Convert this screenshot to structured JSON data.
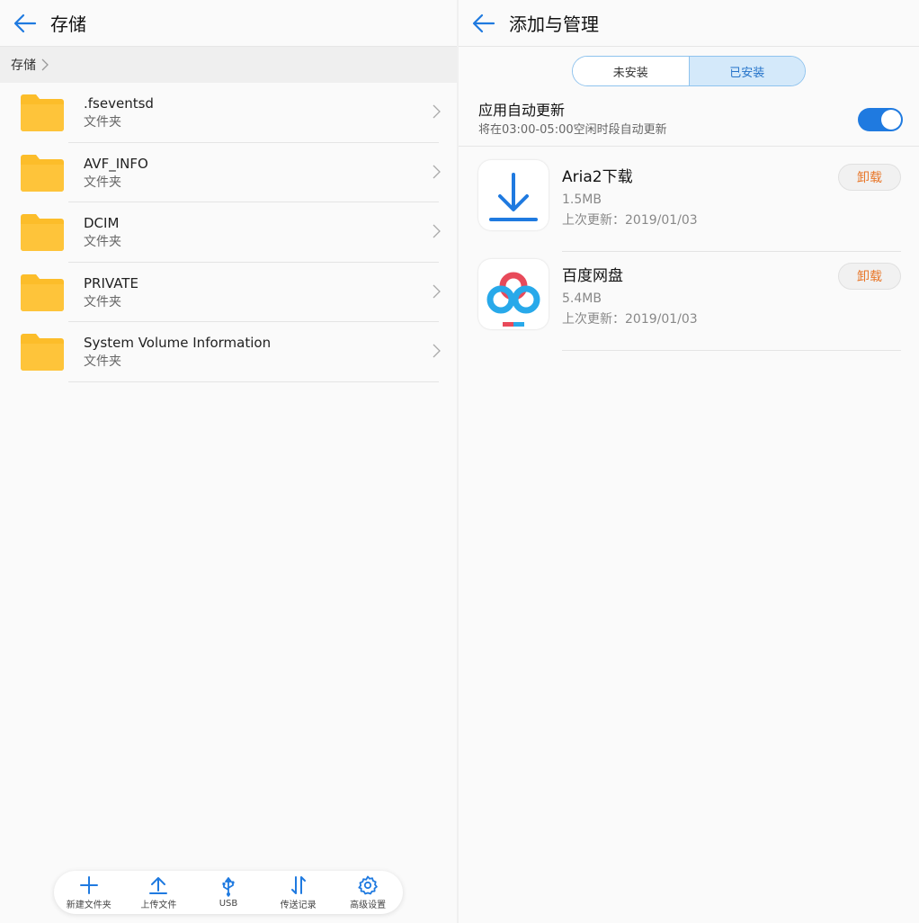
{
  "left": {
    "title": "存储",
    "breadcrumb": "存储",
    "folders": [
      {
        "name": ".fseventsd",
        "type": "文件夹"
      },
      {
        "name": "AVF_INFO",
        "type": "文件夹"
      },
      {
        "name": "DCIM",
        "type": "文件夹"
      },
      {
        "name": "PRIVATE",
        "type": "文件夹"
      },
      {
        "name": "System Volume Information",
        "type": "文件夹"
      }
    ],
    "toolbar": {
      "new_folder": "新建文件夹",
      "upload": "上传文件",
      "usb": "USB",
      "transfer": "传送记录",
      "settings": "高级设置"
    }
  },
  "right": {
    "title": "添加与管理",
    "tabs": {
      "not_installed": "未安装",
      "installed": "已安装",
      "active": "installed"
    },
    "auto_update": {
      "title": "应用自动更新",
      "desc": "将在03:00-05:00空闲时段自动更新",
      "enabled": true
    },
    "apps": [
      {
        "name": "Aria2下载",
        "size": "1.5MB",
        "updated": "上次更新：2019/01/03",
        "action": "卸载",
        "icon": "download-icon"
      },
      {
        "name": "百度网盘",
        "size": "5.4MB",
        "updated": "上次更新：2019/01/03",
        "action": "卸载",
        "icon": "baidu-netdisk-icon"
      }
    ]
  },
  "colors": {
    "accent": "#1f7ae0",
    "folder": "#fcbd2a",
    "uninstall": "#e8772a"
  }
}
